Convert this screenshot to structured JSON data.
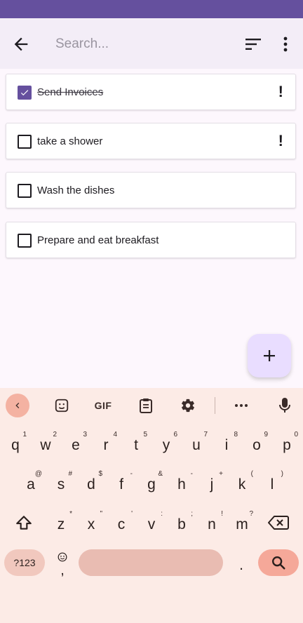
{
  "colors": {
    "status_bar": "#65509e",
    "app_bar": "#f3edf7",
    "background": "#fdf7fd",
    "checkbox_checked": "#65509e",
    "fab": "#e9ddff",
    "keyboard": "#fcebe6",
    "keyboard_accent": "#f5a899"
  },
  "appbar": {
    "search_placeholder": "Search...",
    "back_icon": "arrow-left-icon",
    "sort_icon": "sort-icon",
    "more_icon": "more-vert-icon"
  },
  "tasks": [
    {
      "label": "Send Invoices",
      "checked": true,
      "priority": "!"
    },
    {
      "label": "take a shower",
      "checked": false,
      "priority": "!"
    },
    {
      "label": "Wash the dishes",
      "checked": false,
      "priority": ""
    },
    {
      "label": "Prepare and eat breakfast",
      "checked": false,
      "priority": ""
    }
  ],
  "fab": {
    "icon": "plus-icon",
    "label": "+"
  },
  "keyboard": {
    "toolbar": {
      "gif_label": "GIF"
    },
    "rows": [
      [
        {
          "k": "q",
          "h": "1"
        },
        {
          "k": "w",
          "h": "2"
        },
        {
          "k": "e",
          "h": "3"
        },
        {
          "k": "r",
          "h": "4"
        },
        {
          "k": "t",
          "h": "5"
        },
        {
          "k": "y",
          "h": "6"
        },
        {
          "k": "u",
          "h": "7"
        },
        {
          "k": "i",
          "h": "8"
        },
        {
          "k": "o",
          "h": "9"
        },
        {
          "k": "p",
          "h": "0"
        }
      ],
      [
        {
          "k": "a",
          "h": "@"
        },
        {
          "k": "s",
          "h": "#"
        },
        {
          "k": "d",
          "h": "$"
        },
        {
          "k": "f",
          "h": "-"
        },
        {
          "k": "g",
          "h": "&"
        },
        {
          "k": "h",
          "h": "-"
        },
        {
          "k": "j",
          "h": "+"
        },
        {
          "k": "k",
          "h": "("
        },
        {
          "k": "l",
          "h": ")"
        }
      ],
      [
        {
          "k": "z",
          "h": "*"
        },
        {
          "k": "x",
          "h": "\""
        },
        {
          "k": "c",
          "h": "'"
        },
        {
          "k": "v",
          "h": ":"
        },
        {
          "k": "b",
          "h": ";"
        },
        {
          "k": "n",
          "h": "!"
        },
        {
          "k": "m",
          "h": "?"
        }
      ]
    ],
    "symbols_label": "?123",
    "comma_label": ",",
    "period_label": ".",
    "emoji_icon": "emoji-icon"
  }
}
